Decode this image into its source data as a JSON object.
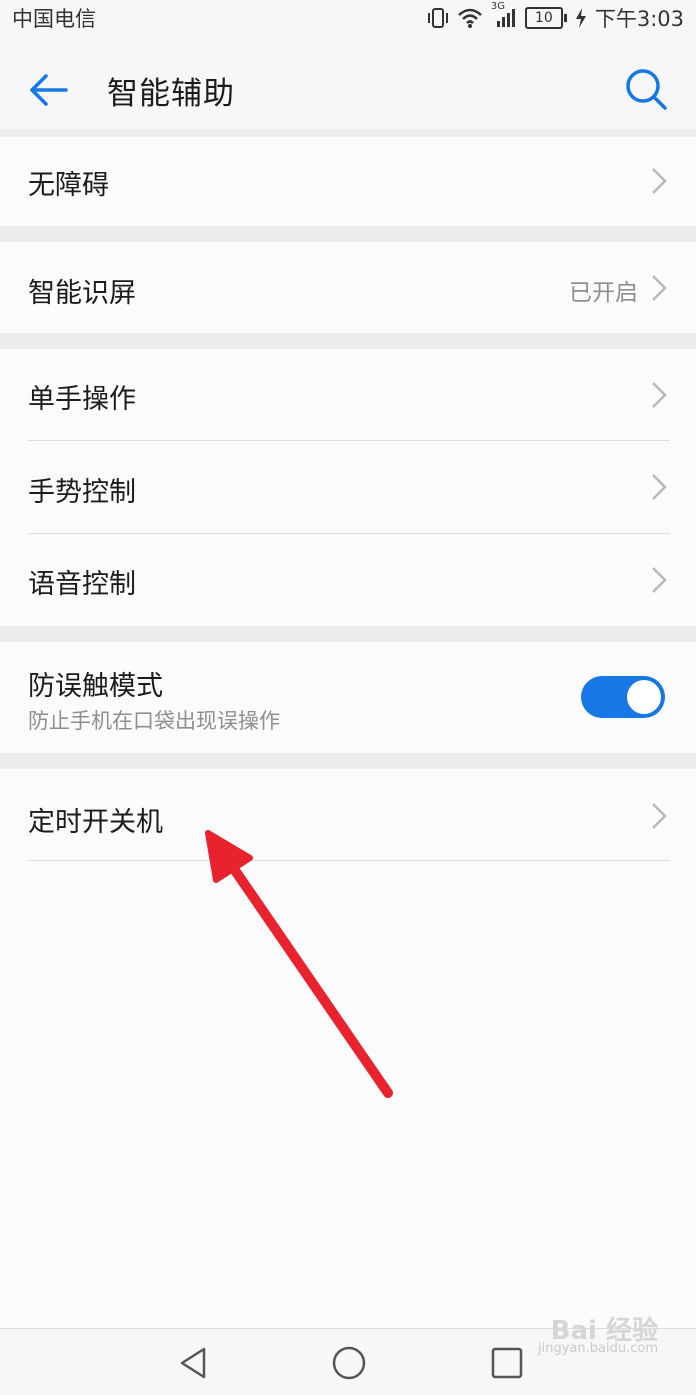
{
  "status_bar": {
    "carrier": "中国电信",
    "network": "3G",
    "battery": "10",
    "time": "下午3:03"
  },
  "header": {
    "title": "智能辅助",
    "back_icon": "arrow-left-icon",
    "search_icon": "search-icon",
    "accent_color": "#1677e6"
  },
  "settings": {
    "accessibility": {
      "label": "无障碍"
    },
    "smart_screen": {
      "label": "智能识屏",
      "value": "已开启"
    },
    "one_hand": {
      "label": "单手操作"
    },
    "gesture": {
      "label": "手势控制"
    },
    "voice": {
      "label": "语音控制"
    },
    "anti_touch": {
      "label": "防误触模式",
      "description": "防止手机在口袋出现误操作",
      "enabled": true
    },
    "scheduled_power": {
      "label": "定时开关机"
    }
  },
  "nav_bar": {
    "back_icon": "triangle-back-icon",
    "home_icon": "circle-home-icon",
    "recents_icon": "square-recents-icon"
  },
  "watermark": {
    "brand": "Bai 经验",
    "url": "jingyan.baidu.com"
  }
}
